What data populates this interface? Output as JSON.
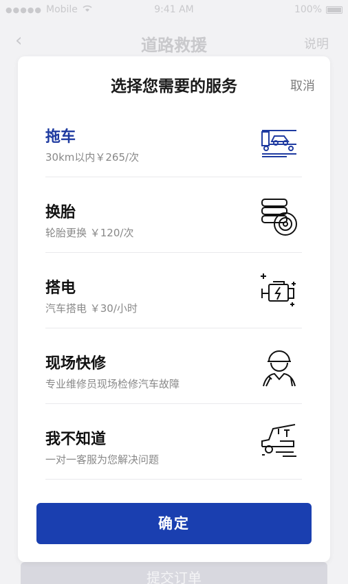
{
  "status_bar": {
    "carrier": "Mobile",
    "time": "9:41 AM",
    "battery": "100%"
  },
  "nav": {
    "title": "道路救援",
    "help": "说明"
  },
  "background_button": "提交订单",
  "modal": {
    "title": "选择您需要的服务",
    "cancel": "取消",
    "confirm": "确定",
    "items": [
      {
        "name": "拖车",
        "desc": "30km以内￥265/次",
        "icon": "tow-truck-icon",
        "selected": true
      },
      {
        "name": "换胎",
        "desc": "轮胎更换 ￥120/次",
        "icon": "tire-stack-icon",
        "selected": false
      },
      {
        "name": "搭电",
        "desc": "汽车搭电 ￥30/小时",
        "icon": "battery-engine-icon",
        "selected": false
      },
      {
        "name": "现场快修",
        "desc": "专业维修员现场检修汽车故障",
        "icon": "mechanic-icon",
        "selected": false
      },
      {
        "name": "我不知道",
        "desc": "一对一客服为您解决问题",
        "icon": "car-hood-open-icon",
        "selected": false
      }
    ]
  },
  "colors": {
    "accent": "#1a3fb0",
    "selected_text": "#1e3aa0"
  }
}
